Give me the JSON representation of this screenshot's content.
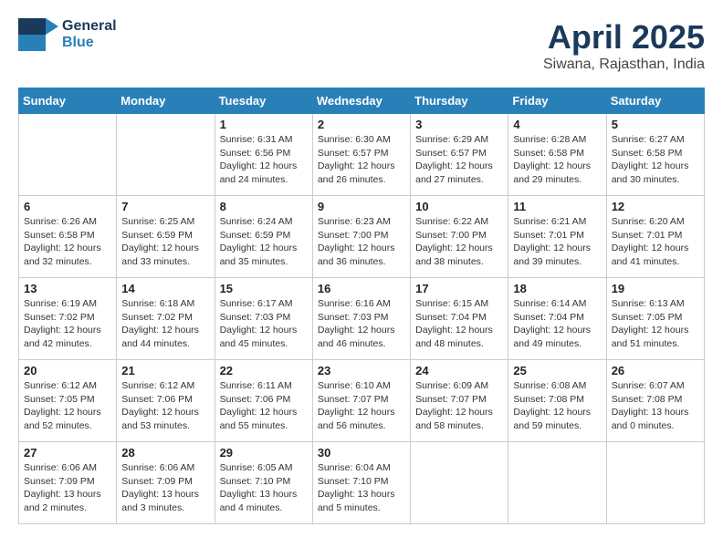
{
  "logo": {
    "general": "General",
    "blue": "Blue"
  },
  "title": "April 2025",
  "subtitle": "Siwana, Rajasthan, India",
  "days_of_week": [
    "Sunday",
    "Monday",
    "Tuesday",
    "Wednesday",
    "Thursday",
    "Friday",
    "Saturday"
  ],
  "weeks": [
    [
      {
        "day": null,
        "info": null
      },
      {
        "day": null,
        "info": null
      },
      {
        "day": "1",
        "sunrise": "6:31 AM",
        "sunset": "6:56 PM",
        "daylight": "12 hours and 24 minutes."
      },
      {
        "day": "2",
        "sunrise": "6:30 AM",
        "sunset": "6:57 PM",
        "daylight": "12 hours and 26 minutes."
      },
      {
        "day": "3",
        "sunrise": "6:29 AM",
        "sunset": "6:57 PM",
        "daylight": "12 hours and 27 minutes."
      },
      {
        "day": "4",
        "sunrise": "6:28 AM",
        "sunset": "6:58 PM",
        "daylight": "12 hours and 29 minutes."
      },
      {
        "day": "5",
        "sunrise": "6:27 AM",
        "sunset": "6:58 PM",
        "daylight": "12 hours and 30 minutes."
      }
    ],
    [
      {
        "day": "6",
        "sunrise": "6:26 AM",
        "sunset": "6:58 PM",
        "daylight": "12 hours and 32 minutes."
      },
      {
        "day": "7",
        "sunrise": "6:25 AM",
        "sunset": "6:59 PM",
        "daylight": "12 hours and 33 minutes."
      },
      {
        "day": "8",
        "sunrise": "6:24 AM",
        "sunset": "6:59 PM",
        "daylight": "12 hours and 35 minutes."
      },
      {
        "day": "9",
        "sunrise": "6:23 AM",
        "sunset": "7:00 PM",
        "daylight": "12 hours and 36 minutes."
      },
      {
        "day": "10",
        "sunrise": "6:22 AM",
        "sunset": "7:00 PM",
        "daylight": "12 hours and 38 minutes."
      },
      {
        "day": "11",
        "sunrise": "6:21 AM",
        "sunset": "7:01 PM",
        "daylight": "12 hours and 39 minutes."
      },
      {
        "day": "12",
        "sunrise": "6:20 AM",
        "sunset": "7:01 PM",
        "daylight": "12 hours and 41 minutes."
      }
    ],
    [
      {
        "day": "13",
        "sunrise": "6:19 AM",
        "sunset": "7:02 PM",
        "daylight": "12 hours and 42 minutes."
      },
      {
        "day": "14",
        "sunrise": "6:18 AM",
        "sunset": "7:02 PM",
        "daylight": "12 hours and 44 minutes."
      },
      {
        "day": "15",
        "sunrise": "6:17 AM",
        "sunset": "7:03 PM",
        "daylight": "12 hours and 45 minutes."
      },
      {
        "day": "16",
        "sunrise": "6:16 AM",
        "sunset": "7:03 PM",
        "daylight": "12 hours and 46 minutes."
      },
      {
        "day": "17",
        "sunrise": "6:15 AM",
        "sunset": "7:04 PM",
        "daylight": "12 hours and 48 minutes."
      },
      {
        "day": "18",
        "sunrise": "6:14 AM",
        "sunset": "7:04 PM",
        "daylight": "12 hours and 49 minutes."
      },
      {
        "day": "19",
        "sunrise": "6:13 AM",
        "sunset": "7:05 PM",
        "daylight": "12 hours and 51 minutes."
      }
    ],
    [
      {
        "day": "20",
        "sunrise": "6:12 AM",
        "sunset": "7:05 PM",
        "daylight": "12 hours and 52 minutes."
      },
      {
        "day": "21",
        "sunrise": "6:12 AM",
        "sunset": "7:06 PM",
        "daylight": "12 hours and 53 minutes."
      },
      {
        "day": "22",
        "sunrise": "6:11 AM",
        "sunset": "7:06 PM",
        "daylight": "12 hours and 55 minutes."
      },
      {
        "day": "23",
        "sunrise": "6:10 AM",
        "sunset": "7:07 PM",
        "daylight": "12 hours and 56 minutes."
      },
      {
        "day": "24",
        "sunrise": "6:09 AM",
        "sunset": "7:07 PM",
        "daylight": "12 hours and 58 minutes."
      },
      {
        "day": "25",
        "sunrise": "6:08 AM",
        "sunset": "7:08 PM",
        "daylight": "12 hours and 59 minutes."
      },
      {
        "day": "26",
        "sunrise": "6:07 AM",
        "sunset": "7:08 PM",
        "daylight": "13 hours and 0 minutes."
      }
    ],
    [
      {
        "day": "27",
        "sunrise": "6:06 AM",
        "sunset": "7:09 PM",
        "daylight": "13 hours and 2 minutes."
      },
      {
        "day": "28",
        "sunrise": "6:06 AM",
        "sunset": "7:09 PM",
        "daylight": "13 hours and 3 minutes."
      },
      {
        "day": "29",
        "sunrise": "6:05 AM",
        "sunset": "7:10 PM",
        "daylight": "13 hours and 4 minutes."
      },
      {
        "day": "30",
        "sunrise": "6:04 AM",
        "sunset": "7:10 PM",
        "daylight": "13 hours and 5 minutes."
      },
      {
        "day": null,
        "info": null
      },
      {
        "day": null,
        "info": null
      },
      {
        "day": null,
        "info": null
      }
    ]
  ],
  "labels": {
    "sunrise": "Sunrise:",
    "sunset": "Sunset:",
    "daylight": "Daylight:"
  }
}
